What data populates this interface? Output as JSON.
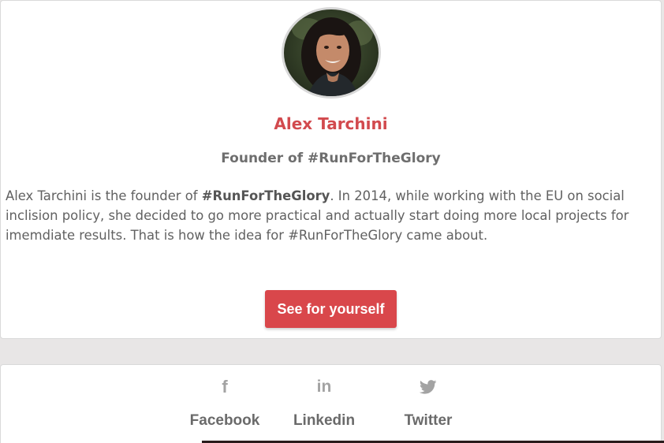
{
  "profile": {
    "name": "Alex Tarchini",
    "role": "Founder of #RunForTheGlory",
    "bio": {
      "part1": "Alex Tarchini is the founder of ",
      "bold": "#RunForTheGlory",
      "part2": ". In 2014, while working with the EU on social inclision policy, she decided to go more practical and actually start doing more local projects for imemdiate results. That is how the idea for #RunForTheGlory came about."
    },
    "cta_label": "See for yourself",
    "avatar_alt": "Alex Tarchini"
  },
  "social": {
    "items": [
      {
        "icon": "facebook-icon",
        "glyph": "f",
        "label": "Facebook"
      },
      {
        "icon": "linkedin-icon",
        "glyph": "in",
        "label": "Linkedin"
      },
      {
        "icon": "twitter-icon",
        "glyph": "",
        "label": "Twitter"
      }
    ]
  },
  "colors": {
    "accent": "#d9474b",
    "name": "#d24a4e",
    "text": "#616161",
    "icon": "#a3a3a3",
    "background": "#e8e6e6"
  }
}
